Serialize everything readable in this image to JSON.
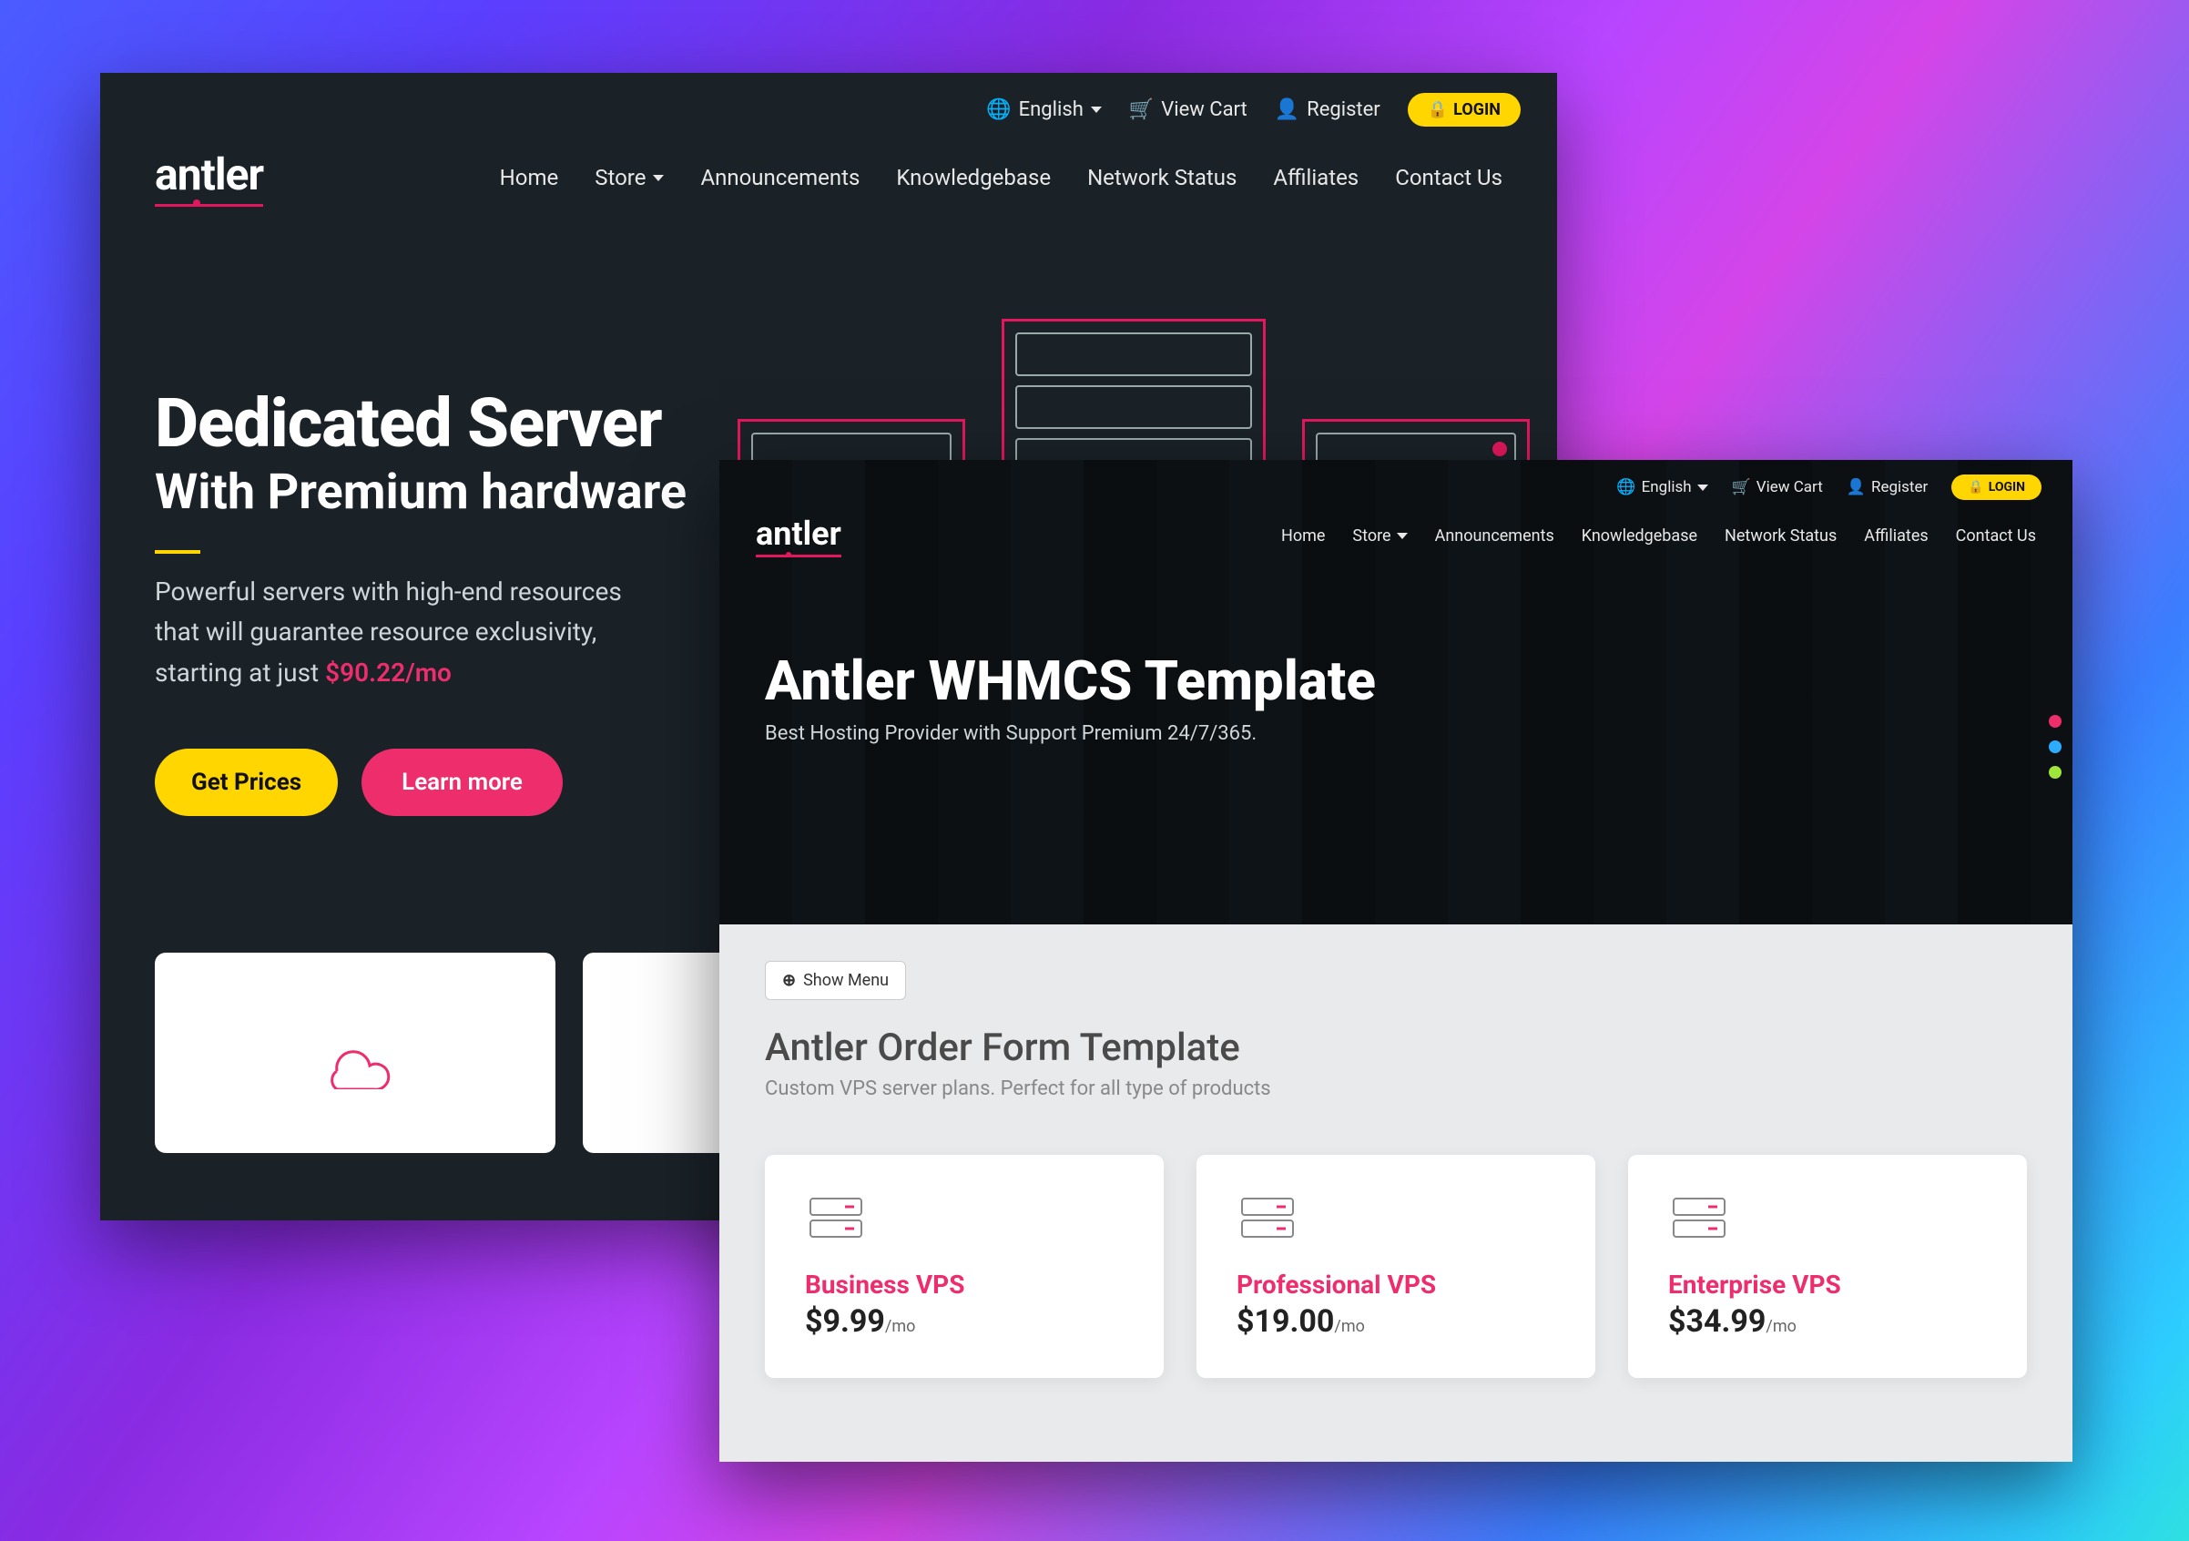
{
  "colors": {
    "pink": "#ee2d6c",
    "yellow": "#ffd600",
    "blue": "#2dabff",
    "green": "#9ee63a"
  },
  "back": {
    "logo": "antler",
    "topbar": {
      "lang": "English",
      "cart": "View Cart",
      "register": "Register",
      "login": "LOGIN"
    },
    "menu": [
      "Home",
      "Store",
      "Announcements",
      "Knowledgebase",
      "Network Status",
      "Affiliates",
      "Contact Us"
    ],
    "hero": {
      "title": "Dedicated Server",
      "subtitle": "With Premium hardware",
      "desc1": "Powerful servers with high-end resources that will guarantee resource exclusivity, starting at just ",
      "price": "$90.22/mo",
      "btn1": "Get Prices",
      "btn2": "Learn more"
    }
  },
  "front": {
    "logo": "antler",
    "topbar": {
      "lang": "English",
      "cart": "View Cart",
      "register": "Register",
      "login": "LOGIN"
    },
    "menu": [
      "Home",
      "Store",
      "Announcements",
      "Knowledgebase",
      "Network Status",
      "Affiliates",
      "Contact Us"
    ],
    "hero": {
      "title": "Antler WHMCS Template",
      "sub": "Best Hosting Provider with Support Premium 24/7/365."
    },
    "body": {
      "showmenu": "Show Menu",
      "heading": "Antler Order Form Template",
      "sub": "Custom VPS server plans. Perfect for all type of products",
      "plans": [
        {
          "name": "Business VPS",
          "price": "$9.99",
          "per": "/mo"
        },
        {
          "name": "Professional VPS",
          "price": "$19.00",
          "per": "/mo"
        },
        {
          "name": "Enterprise VPS",
          "price": "$34.99",
          "per": "/mo"
        }
      ]
    }
  }
}
